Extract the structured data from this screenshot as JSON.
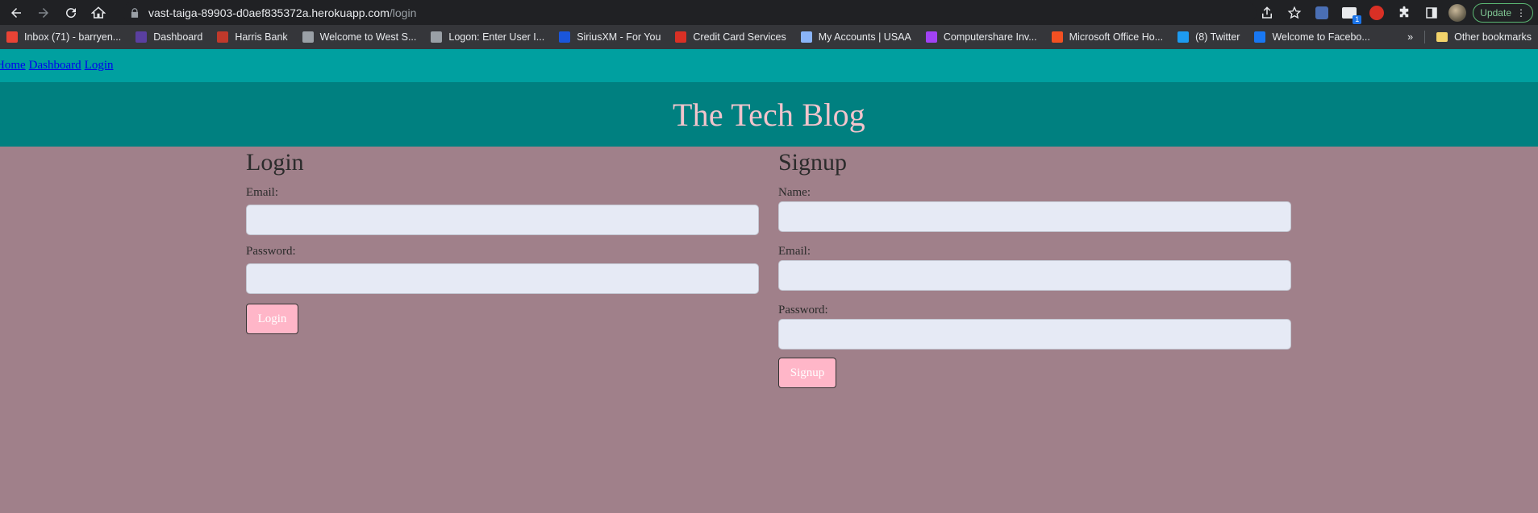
{
  "browser": {
    "url_host": "vast-taiga-89903-d0aef835372a.herokuapp.com",
    "url_path": "/login",
    "update_label": "Update",
    "bookmarks": [
      {
        "label": "Inbox (71) - barryen...",
        "icon": "gmail-icon",
        "color": "#ea4335"
      },
      {
        "label": "Dashboard",
        "icon": "dashboard-n-icon",
        "color": "#5a3fa0"
      },
      {
        "label": "Harris Bank",
        "icon": "harris-bank-icon",
        "color": "#c0392b"
      },
      {
        "label": "Welcome to West S...",
        "icon": "globe-icon",
        "color": "#9aa0a6"
      },
      {
        "label": "Logon: Enter User I...",
        "icon": "globe-icon",
        "color": "#9aa0a6"
      },
      {
        "label": "SiriusXM - For You",
        "icon": "siriusxm-icon",
        "color": "#1a56db"
      },
      {
        "label": "Credit Card Services",
        "icon": "credit-card-icon",
        "color": "#d93025"
      },
      {
        "label": "My Accounts | USAA",
        "icon": "usaa-icon",
        "color": "#8ab4f8"
      },
      {
        "label": "Computershare Inv...",
        "icon": "computershare-icon",
        "color": "#a142f4"
      },
      {
        "label": "Microsoft Office Ho...",
        "icon": "microsoft-icon",
        "color": "#f25022"
      },
      {
        "label": "(8) Twitter",
        "icon": "twitter-icon",
        "color": "#1d9bf0"
      },
      {
        "label": "Welcome to Facebo...",
        "icon": "facebook-icon",
        "color": "#1877f2"
      }
    ],
    "other_bookmarks": "Other bookmarks",
    "more_bookmarks": "»"
  },
  "nav": {
    "home": "Home",
    "dashboard": "Dashboard",
    "login": "Login"
  },
  "header": {
    "title": "The Tech Blog"
  },
  "login": {
    "heading": "Login",
    "email_label": "Email:",
    "email_value": "",
    "password_label": "Password:",
    "password_value": "",
    "button": "Login"
  },
  "signup": {
    "heading": "Signup",
    "name_label": "Name:",
    "name_value": "",
    "email_label": "Email:",
    "email_value": "",
    "password_label": "Password:",
    "password_value": "",
    "button": "Signup"
  },
  "colors": {
    "page_bg": "#a0808a",
    "nav_bg": "#00a0a0",
    "header_bg": "#008080",
    "title": "#f2c4cc",
    "button_bg": "#ffb6c8",
    "input_bg": "#e6eaf5"
  }
}
